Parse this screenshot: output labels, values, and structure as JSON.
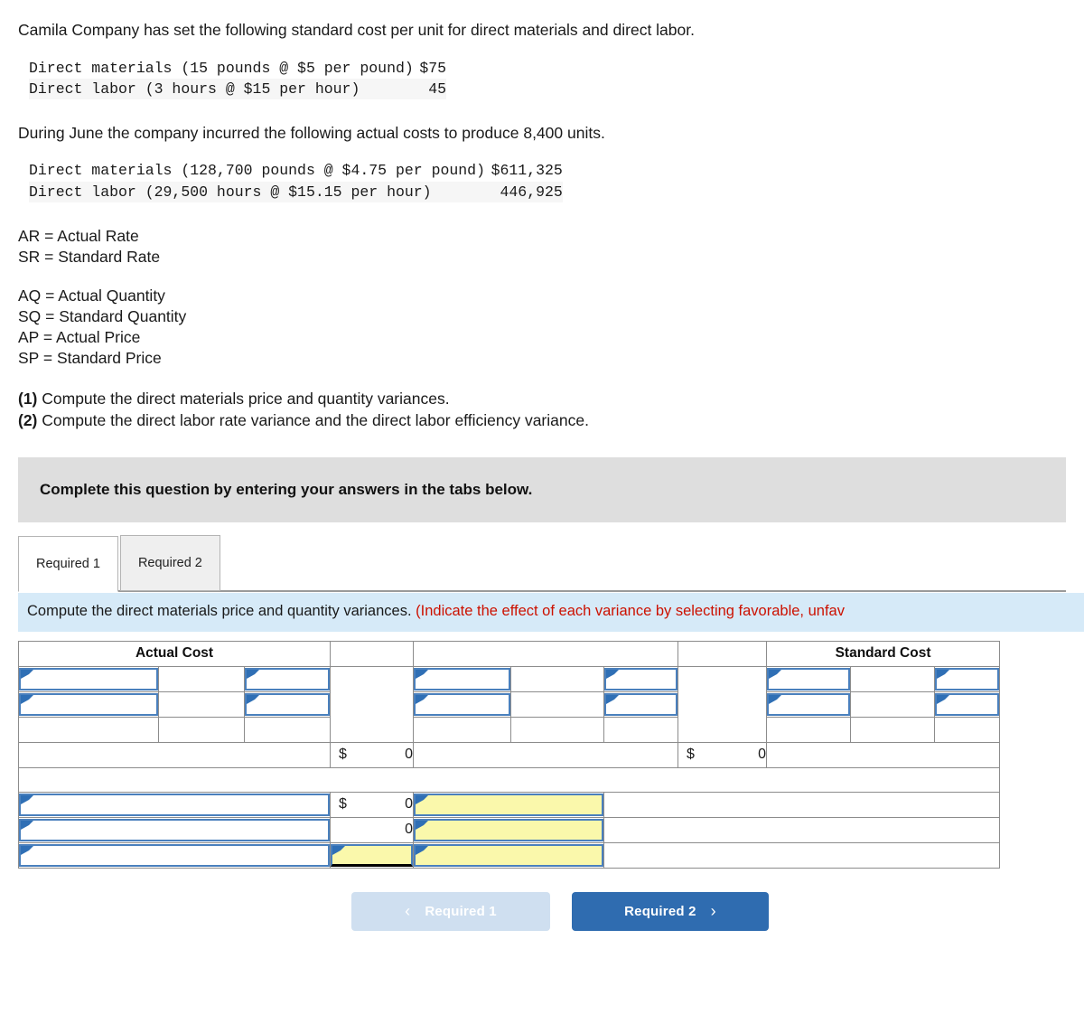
{
  "intro": {
    "line1": "Camila Company has set the following standard cost per unit for direct materials and direct labor.",
    "line2": "During June the company incurred the following actual costs to produce 8,400 units."
  },
  "standard_cost_table": {
    "rows": [
      {
        "label": "Direct materials (15 pounds @ $5 per pound)",
        "currency": "$",
        "value": "75"
      },
      {
        "label": "Direct labor (3 hours @ $15 per hour)",
        "currency": "",
        "value": "45"
      }
    ]
  },
  "actual_cost_table": {
    "rows": [
      {
        "label": "Direct materials (128,700 pounds @ $4.75 per pound)",
        "currency": "$",
        "value": "611,325"
      },
      {
        "label": "Direct labor (29,500 hours @ $15.15 per hour)",
        "currency": "",
        "value": "446,925"
      }
    ]
  },
  "legend": {
    "group1": [
      "AR = Actual Rate",
      "SR = Standard Rate"
    ],
    "group2": [
      "AQ = Actual Quantity",
      "SQ = Standard Quantity",
      "AP = Actual Price",
      "SP = Standard Price"
    ]
  },
  "requirements": [
    {
      "num": "(1)",
      "text": " Compute the direct materials price and quantity variances."
    },
    {
      "num": "(2)",
      "text": " Compute the direct labor rate variance and the direct labor efficiency variance."
    }
  ],
  "banner": {
    "text": "Complete this question by entering your answers in the tabs below."
  },
  "tabs": [
    {
      "label": "Required 1",
      "active": true
    },
    {
      "label": "Required 2",
      "active": false
    }
  ],
  "instruction": {
    "black": "Compute the direct materials price and quantity variances. ",
    "red": "(Indicate the effect of each variance by selecting favorable, unfav"
  },
  "answer_grid": {
    "headers": {
      "actual_cost": "Actual Cost",
      "standard_cost": "Standard Cost"
    },
    "middle_total": {
      "currency": "$",
      "value": "0"
    },
    "right_total": {
      "currency": "$",
      "value": "0"
    },
    "variance_rows": [
      {
        "currency": "$",
        "value": "0"
      },
      {
        "currency": "",
        "value": "0"
      },
      {
        "currency": "",
        "value": ""
      }
    ]
  },
  "footer": {
    "prev_label": "Required 1",
    "next_label": "Required 2",
    "prev_chevron": "‹",
    "next_chevron": "›"
  },
  "colors": {
    "header_blue": "#7eabdf",
    "input_yellow": "#faf8ab",
    "input_border": "#4a80bd",
    "banner_gray": "#dedede",
    "instruction_blue": "#d6eaf8",
    "red_text": "#cc1100",
    "next_button": "#2f6cb0",
    "prev_button": "#cfdff0"
  }
}
